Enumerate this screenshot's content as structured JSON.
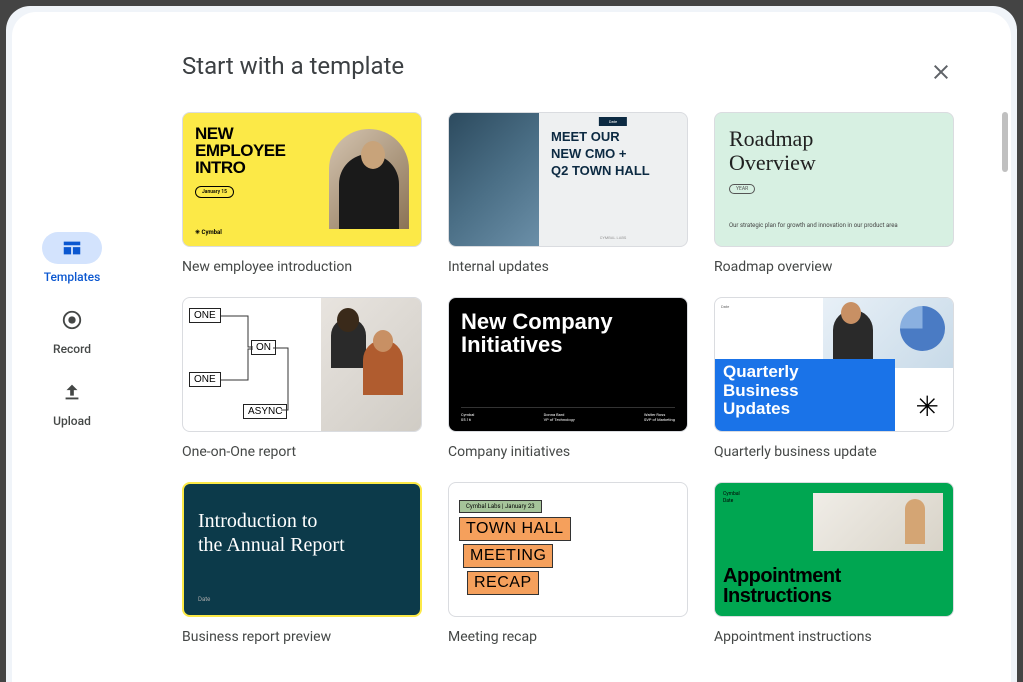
{
  "title": "Start with a template",
  "sidebar": {
    "items": [
      {
        "label": "Templates",
        "active": true
      },
      {
        "label": "Record",
        "active": false
      },
      {
        "label": "Upload",
        "active": false
      }
    ]
  },
  "templates": [
    {
      "label": "New employee introduction",
      "thumb": {
        "title_line1": "NEW",
        "title_line2": "EMPLOYEE",
        "title_line3": "INTRO",
        "date": "January 15",
        "brand": "✳ Cymbal"
      }
    },
    {
      "label": "Internal updates",
      "thumb": {
        "badge": "Date",
        "text": "MEET OUR NEW CMO + Q2 TOWN HALL",
        "footer": "CYMBAL LABS"
      }
    },
    {
      "label": "Roadmap overview",
      "thumb": {
        "title": "Roadmap Overview",
        "year": "YEAR",
        "sub": "Our strategic plan for growth and innovation in our product area"
      }
    },
    {
      "label": "One-on-One report",
      "thumb": {
        "box_one_1": "ONE",
        "box_on": "ON",
        "box_one_2": "ONE",
        "box_async": "ASYNC"
      }
    },
    {
      "label": "Company initiatives",
      "thumb": {
        "title": "New Company Initiatives",
        "footer_brand": "Cymbal",
        "footer_date": "05.16",
        "person1_name": "Donna Bard",
        "person1_role": "VP of Technology",
        "person2_name": "Walter Ross",
        "person2_role": "SVP of Marketing"
      }
    },
    {
      "label": "Quarterly business update",
      "thumb": {
        "date": "Date",
        "text": "Quarterly Business Updates"
      }
    },
    {
      "label": "Business report preview",
      "thumb": {
        "title": "Introduction to the Annual Report",
        "date": "Date"
      }
    },
    {
      "label": "Meeting recap",
      "thumb": {
        "badge": "Cymbal Labs  |  January 23",
        "line1": "TOWN HALL",
        "line2": "MEETING",
        "line3": "RECAP"
      }
    },
    {
      "label": "Appointment instructions",
      "thumb": {
        "brand": "Cymbal",
        "date": "Date",
        "title": "Appointment Instructions"
      }
    }
  ]
}
